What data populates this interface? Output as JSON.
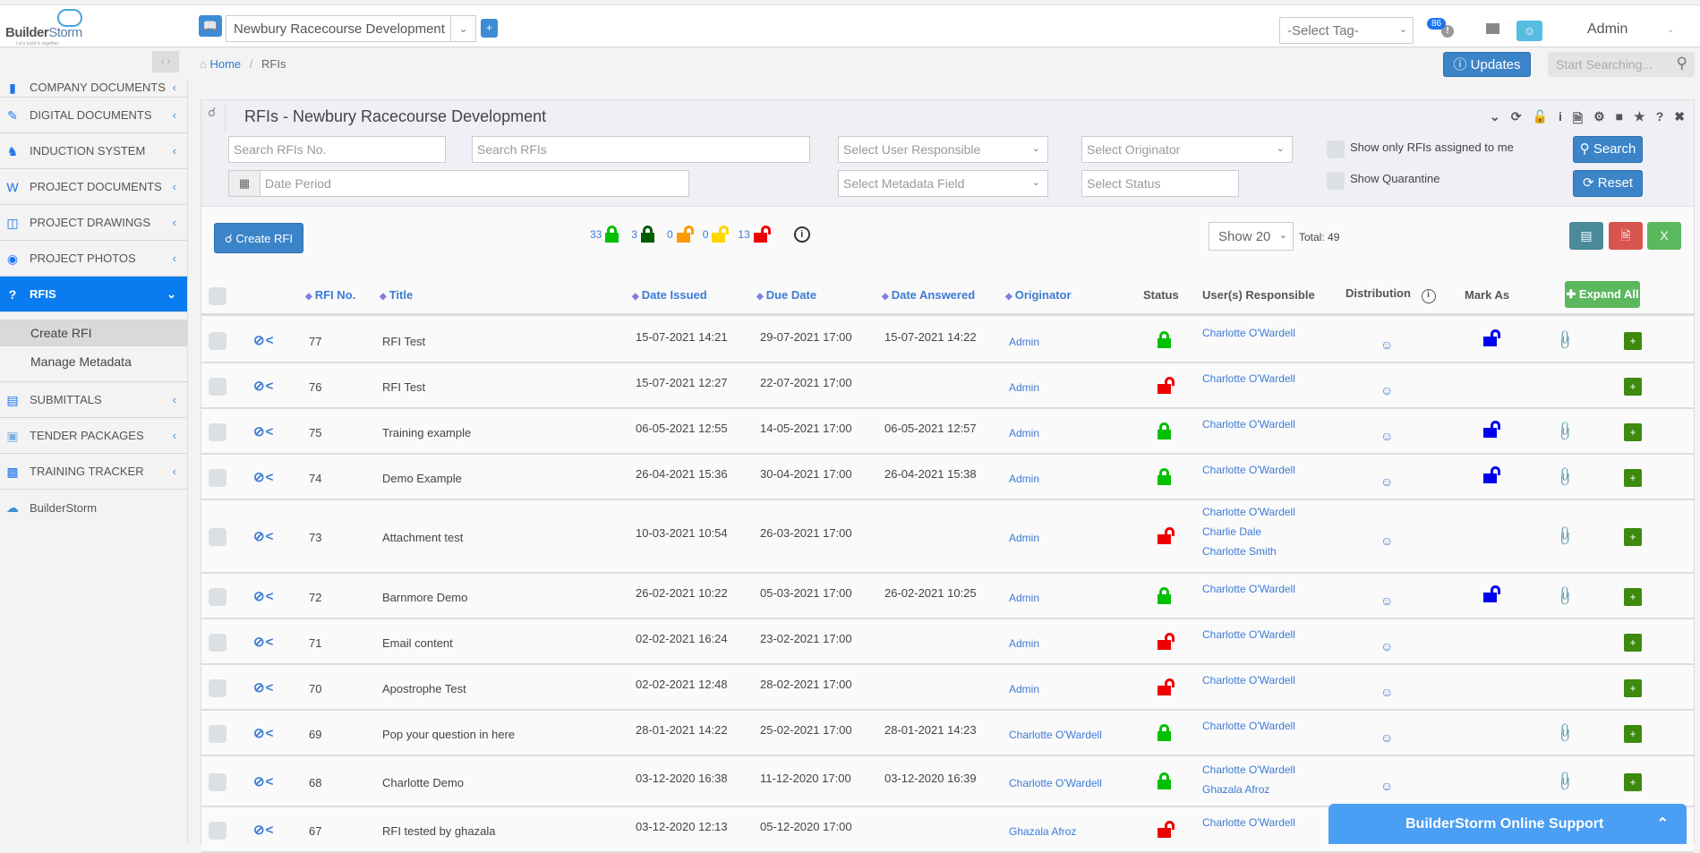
{
  "app": {
    "logo_name": "BuilderStorm",
    "logo_tagline": "Let's build it, together."
  },
  "topbar": {
    "project": "Newbury Racecourse Development",
    "add_label": "+",
    "tag_select": "-Select Tag-",
    "notification_count": "86",
    "user": "Admin"
  },
  "breadcrumb": {
    "home": "Home",
    "current": "RFIs"
  },
  "updates_label": "Updates",
  "global_search_placeholder": "Start Searching...",
  "sidebar": {
    "items": [
      {
        "label": "COMPANY DOCUMENTS",
        "icon": "folder-icon"
      },
      {
        "label": "DIGITAL DOCUMENTS",
        "icon": "edit-doc-icon"
      },
      {
        "label": "INDUCTION SYSTEM",
        "icon": "users-icon"
      },
      {
        "label": "PROJECT DOCUMENTS",
        "icon": "word-doc-icon"
      },
      {
        "label": "PROJECT DRAWINGS",
        "icon": "drawing-icon"
      },
      {
        "label": "PROJECT PHOTOS",
        "icon": "camera-icon"
      },
      {
        "label": "RFIS",
        "icon": "question-icon",
        "active": true
      },
      {
        "label": "SUBMITTALS",
        "icon": "submittal-icon"
      },
      {
        "label": "TENDER PACKAGES",
        "icon": "package-icon"
      },
      {
        "label": "TRAINING TRACKER",
        "icon": "tracker-icon"
      },
      {
        "label": "BuilderStorm",
        "icon": "cloud-icon"
      }
    ],
    "rfi_sub": [
      "Create RFI",
      "Manage Metadata"
    ]
  },
  "panel": {
    "title": "RFIs - Newbury Racecourse Development",
    "filters": {
      "search_no": "Search RFIs No.",
      "search": "Search RFIs",
      "date_period": "Date Period",
      "user_responsible": "Select User Responsible",
      "originator": "Select Originator",
      "metadata": "Select Metadata Field",
      "status": "Select Status",
      "only_mine": "Show only RFIs assigned to me",
      "quarantine": "Show Quarantine",
      "search_btn": "Search",
      "reset_btn": "Reset"
    },
    "create_label": "Create RFI",
    "status_counts": [
      {
        "count": "33",
        "color": "#00c000",
        "open": false
      },
      {
        "count": "3",
        "color": "#005a00",
        "open": false
      },
      {
        "count": "0",
        "color": "#ff9900",
        "open": true
      },
      {
        "count": "0",
        "color": "#ffd700",
        "open": true
      },
      {
        "count": "13",
        "color": "#ee0000",
        "open": true
      }
    ],
    "show_label": "Show 20",
    "total_label": "Total: 49",
    "expand_all": "Expand All"
  },
  "table": {
    "headers": {
      "rfi_no": "RFI No.",
      "title": "Title",
      "date_issued": "Date Issued",
      "due_date": "Due Date",
      "date_answered": "Date Answered",
      "originator": "Originator",
      "status": "Status",
      "users": "User(s) Responsible",
      "distribution": "Distribution",
      "mark_as": "Mark As"
    },
    "rows": [
      {
        "no": "77",
        "title": "RFI Test",
        "issued": "15-07-2021 14:21",
        "due": "29-07-2021 17:00",
        "answered": "15-07-2021 14:22",
        "originator": "Admin",
        "status": "closed",
        "users": [
          "Charlotte O'Wardell"
        ],
        "mark": true,
        "attach": true
      },
      {
        "no": "76",
        "title": "RFI Test",
        "issued": "15-07-2021 12:27",
        "due": "22-07-2021 17:00",
        "answered": "",
        "originator": "Admin",
        "status": "open",
        "users": [
          "Charlotte O'Wardell"
        ],
        "mark": false,
        "attach": false
      },
      {
        "no": "75",
        "title": "Training example",
        "issued": "06-05-2021 12:55",
        "due": "14-05-2021 17:00",
        "answered": "06-05-2021 12:57",
        "originator": "Admin",
        "status": "closed",
        "users": [
          "Charlotte O'Wardell"
        ],
        "mark": true,
        "attach": true
      },
      {
        "no": "74",
        "title": "Demo Example",
        "issued": "26-04-2021 15:36",
        "due": "30-04-2021 17:00",
        "answered": "26-04-2021 15:38",
        "originator": "Admin",
        "status": "closed",
        "users": [
          "Charlotte O'Wardell"
        ],
        "mark": true,
        "attach": true
      },
      {
        "no": "73",
        "title": "Attachment test",
        "issued": "10-03-2021 10:54",
        "due": "26-03-2021 17:00",
        "answered": "",
        "originator": "Admin",
        "status": "open",
        "users": [
          "Charlotte O'Wardell",
          "Charlie Dale",
          "Charlotte Smith"
        ],
        "mark": false,
        "attach": true
      },
      {
        "no": "72",
        "title": "Barnmore Demo",
        "issued": "26-02-2021 10:22",
        "due": "05-03-2021 17:00",
        "answered": "26-02-2021 10:25",
        "originator": "Admin",
        "status": "closed",
        "users": [
          "Charlotte O'Wardell"
        ],
        "mark": true,
        "attach": true
      },
      {
        "no": "71",
        "title": "Email content",
        "issued": "02-02-2021 16:24",
        "due": "23-02-2021 17:00",
        "answered": "",
        "originator": "Admin",
        "status": "open",
        "users": [
          "Charlotte O'Wardell"
        ],
        "mark": false,
        "attach": false
      },
      {
        "no": "70",
        "title": "Apostrophe Test",
        "issued": "02-02-2021 12:48",
        "due": "28-02-2021 17:00",
        "answered": "",
        "originator": "Admin",
        "status": "open",
        "users": [
          "Charlotte O'Wardell"
        ],
        "mark": false,
        "attach": false
      },
      {
        "no": "69",
        "title": "Pop your question in here",
        "issued": "28-01-2021 14:22",
        "due": "25-02-2021 17:00",
        "answered": "28-01-2021 14:23",
        "originator": "Charlotte O'Wardell",
        "status": "closed",
        "users": [
          "Charlotte O'Wardell"
        ],
        "mark": false,
        "attach": true
      },
      {
        "no": "68",
        "title": "Charlotte Demo",
        "issued": "03-12-2020 16:38",
        "due": "11-12-2020 17:00",
        "answered": "03-12-2020 16:39",
        "originator": "Charlotte O'Wardell",
        "status": "closed",
        "users": [
          "Charlotte O'Wardell",
          "Ghazala Afroz"
        ],
        "mark": false,
        "attach": true
      },
      {
        "no": "67",
        "title": "RFI tested by ghazala",
        "issued": "03-12-2020 12:13",
        "due": "05-12-2020 17:00",
        "answered": "",
        "originator": "Ghazala Afroz",
        "status": "open",
        "users": [
          "Charlotte O'Wardell"
        ],
        "mark": false,
        "attach": true
      }
    ]
  },
  "support": {
    "label": "BuilderStorm Online Support"
  }
}
